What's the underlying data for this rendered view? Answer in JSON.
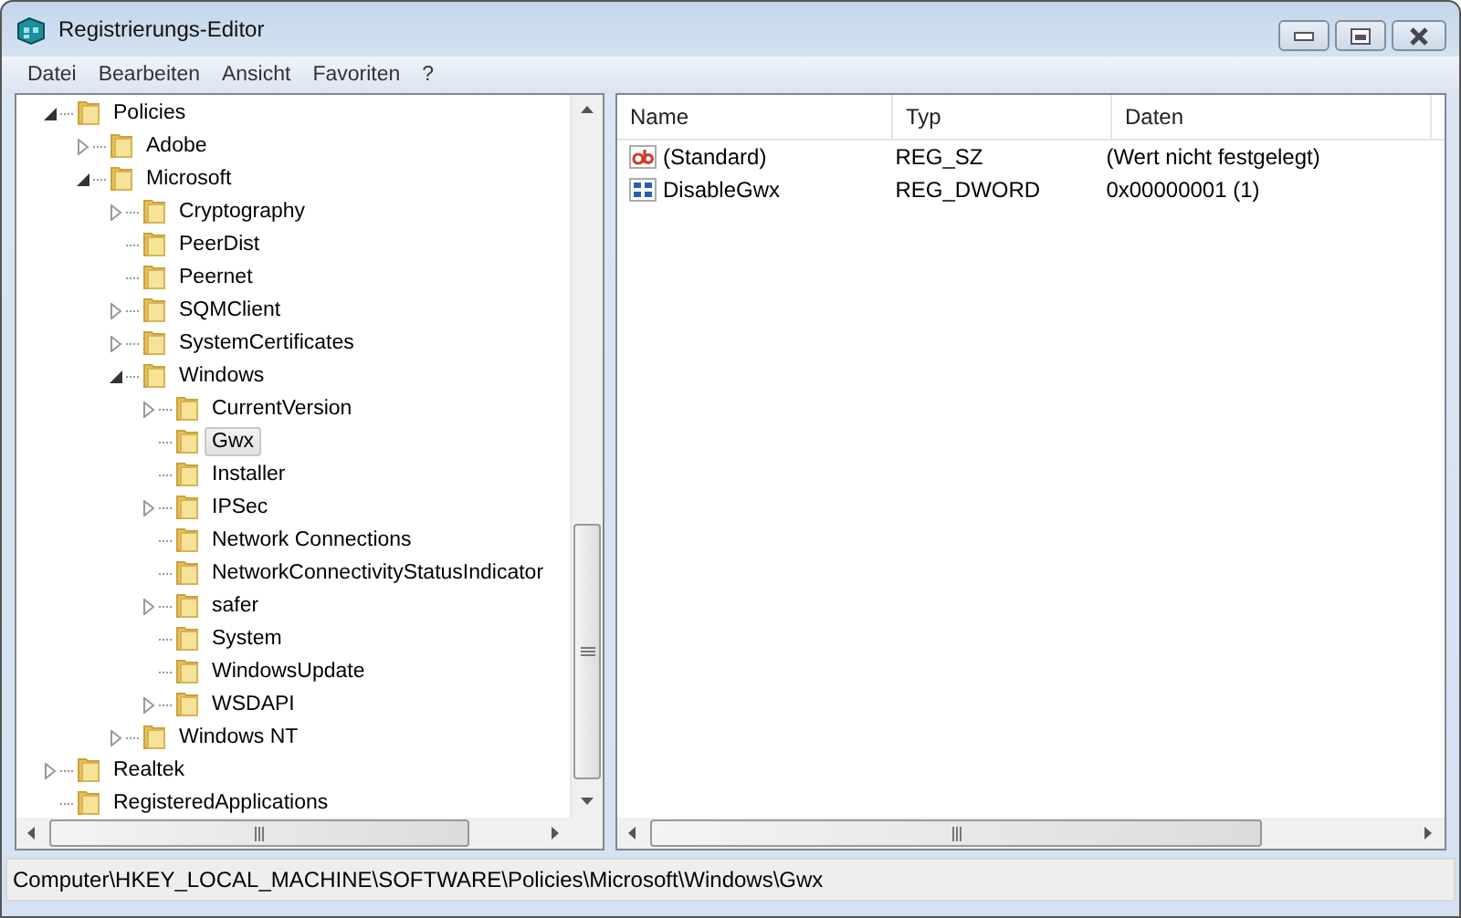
{
  "window": {
    "title": "Registrierungs-Editor"
  },
  "menu": [
    "Datei",
    "Bearbeiten",
    "Ansicht",
    "Favoriten",
    "?"
  ],
  "tree": [
    {
      "label": "Policies",
      "expanded": true,
      "selected": false,
      "children": [
        {
          "label": "Adobe",
          "expanded": false,
          "selected": false
        },
        {
          "label": "Microsoft",
          "expanded": true,
          "selected": false,
          "children": [
            {
              "label": "Cryptography",
              "expanded": false,
              "selected": false
            },
            {
              "label": "PeerDist",
              "selected": false
            },
            {
              "label": "Peernet",
              "selected": false
            },
            {
              "label": "SQMClient",
              "expanded": false,
              "selected": false
            },
            {
              "label": "SystemCertificates",
              "expanded": false,
              "selected": false
            },
            {
              "label": "Windows",
              "expanded": true,
              "selected": false,
              "children": [
                {
                  "label": "CurrentVersion",
                  "expanded": false,
                  "selected": false
                },
                {
                  "label": "Gwx",
                  "selected": true
                },
                {
                  "label": "Installer",
                  "selected": false
                },
                {
                  "label": "IPSec",
                  "expanded": false,
                  "selected": false
                },
                {
                  "label": "Network Connections",
                  "selected": false
                },
                {
                  "label": "NetworkConnectivityStatusIndicator",
                  "selected": false
                },
                {
                  "label": "safer",
                  "expanded": false,
                  "selected": false
                },
                {
                  "label": "System",
                  "selected": false
                },
                {
                  "label": "WindowsUpdate",
                  "selected": false
                },
                {
                  "label": "WSDAPI",
                  "expanded": false,
                  "selected": false
                }
              ]
            },
            {
              "label": "Windows NT",
              "expanded": false,
              "selected": false
            }
          ]
        }
      ]
    },
    {
      "label": "Realtek",
      "expanded": false,
      "selected": false
    },
    {
      "label": "RegisteredApplications",
      "selected": false
    }
  ],
  "values": {
    "columns": [
      "Name",
      "Typ",
      "Daten"
    ],
    "rows": [
      {
        "kind": "string",
        "name": "(Standard)",
        "type": "REG_SZ",
        "data": "(Wert nicht festgelegt)"
      },
      {
        "kind": "binary",
        "name": "DisableGwx",
        "type": "REG_DWORD",
        "data": "0x00000001 (1)"
      }
    ]
  },
  "status_bar": "Computer\\HKEY_LOCAL_MACHINE\\SOFTWARE\\Policies\\Microsoft\\Windows\\Gwx"
}
